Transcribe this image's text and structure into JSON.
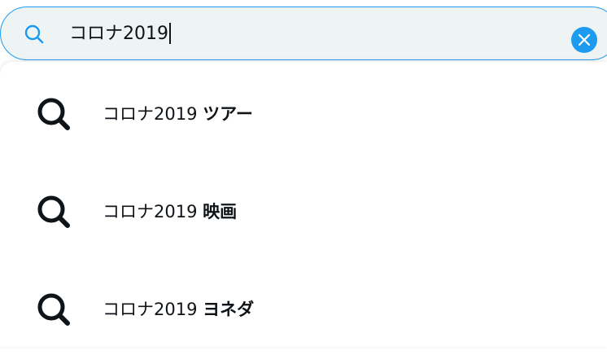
{
  "search": {
    "value": "コロナ2019",
    "icon": "search-icon",
    "clear_icon": "close-icon"
  },
  "suggestions": [
    {
      "query": "コロナ2019",
      "completion": "ツアー",
      "icon": "search-icon"
    },
    {
      "query": "コロナ2019",
      "completion": "映画",
      "icon": "search-icon"
    },
    {
      "query": "コロナ2019",
      "completion": "ヨネダ",
      "icon": "search-icon"
    }
  ],
  "colors": {
    "accent": "#1d9bf0",
    "text": "#0f1419",
    "field_bg": "#eef3f4"
  }
}
